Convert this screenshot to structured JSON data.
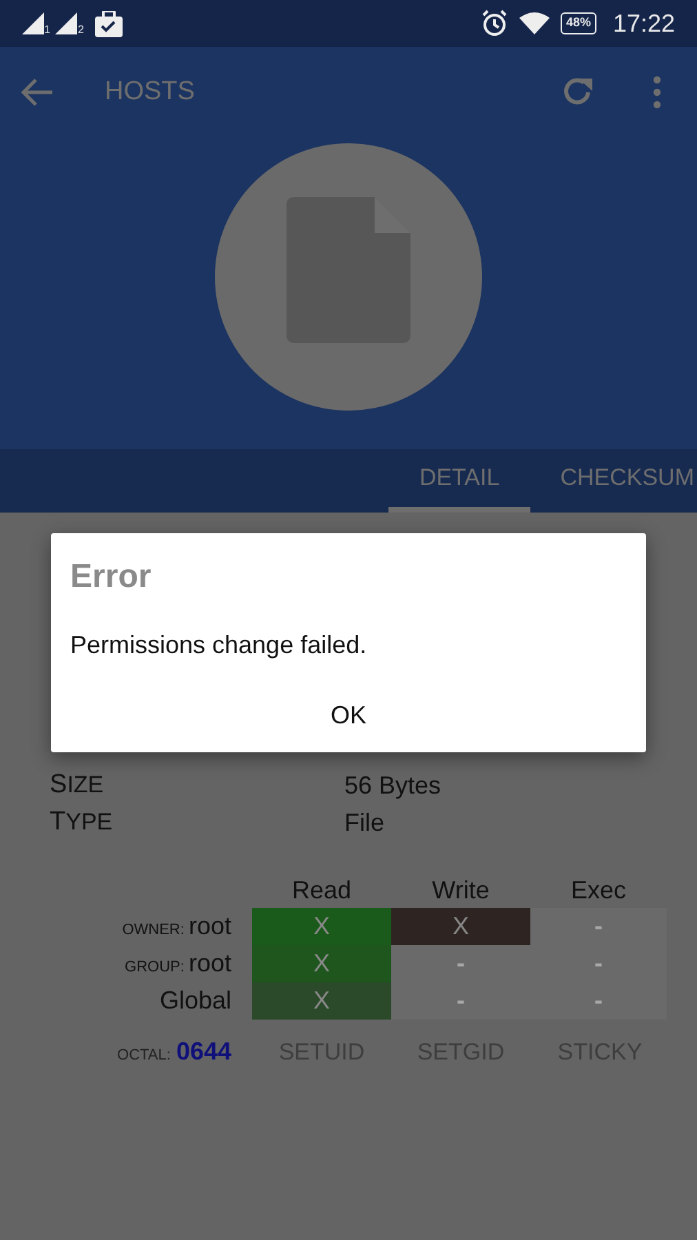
{
  "status_bar": {
    "sims": [
      "1",
      "2"
    ],
    "battery": "48%",
    "time": "17:22"
  },
  "toolbar": {
    "title": "HOSTS"
  },
  "tabs": [
    {
      "label": "DETAIL",
      "selected": true
    },
    {
      "label": "CHECKSUM",
      "selected": false
    }
  ],
  "details": [
    {
      "label": "SIZE",
      "value": "56 Bytes"
    },
    {
      "label": "TYPE",
      "value": "File"
    }
  ],
  "permissions": {
    "columns": [
      "Read",
      "Write",
      "Exec"
    ],
    "rows": [
      {
        "prefix": "OWNER:",
        "name": "root",
        "cells": [
          {
            "text": "X",
            "checked": true
          },
          {
            "text": "X",
            "checked": true
          },
          {
            "text": "-",
            "checked": false
          }
        ]
      },
      {
        "prefix": "GROUP:",
        "name": "root",
        "cells": [
          {
            "text": "X",
            "checked": true
          },
          {
            "text": "-",
            "checked": false
          },
          {
            "text": "-",
            "checked": false
          }
        ]
      },
      {
        "name": "Global",
        "cells": [
          {
            "text": "X",
            "checked": true
          },
          {
            "text": "-",
            "checked": false
          },
          {
            "text": "-",
            "checked": false
          }
        ]
      }
    ],
    "octal_label": "OCTAL:",
    "octal": "0644",
    "special": [
      "SETUID",
      "SETGID",
      "STICKY"
    ]
  },
  "dialog": {
    "title": "Error",
    "message": "Permissions change failed.",
    "button": "OK"
  }
}
